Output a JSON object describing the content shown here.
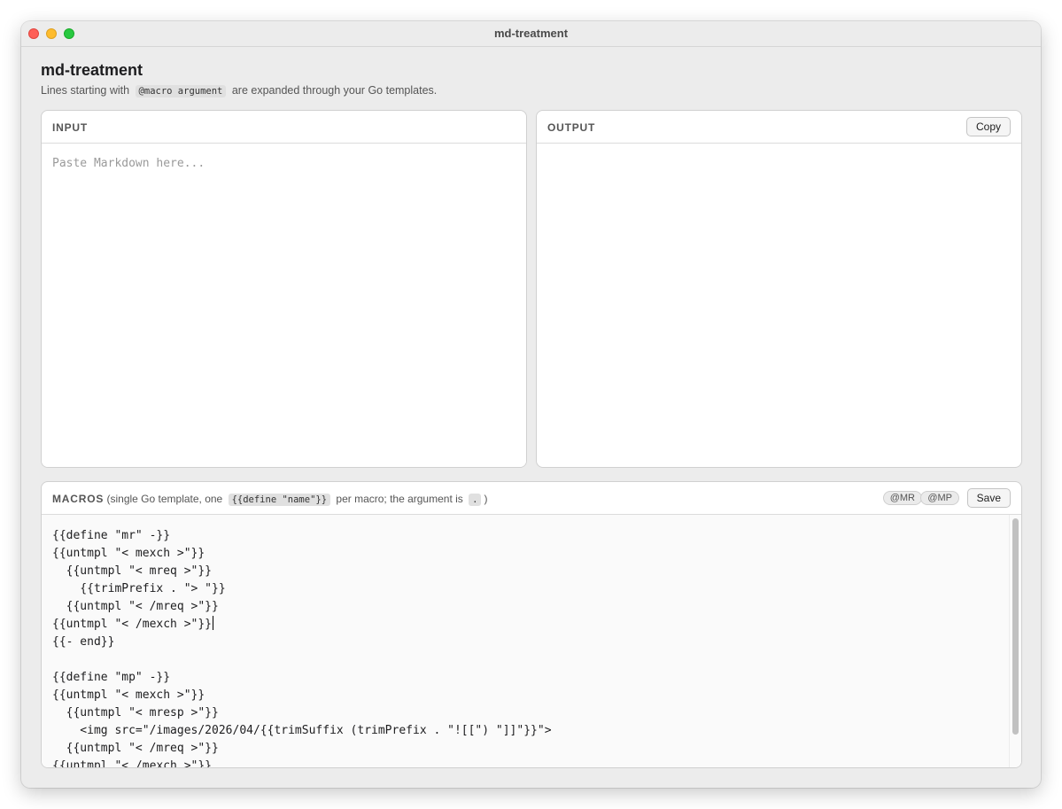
{
  "window": {
    "title": "md-treatment"
  },
  "header": {
    "title": "md-treatment",
    "subtitle_prefix": "Lines starting with",
    "subtitle_code": "@macro argument",
    "subtitle_suffix": "are expanded through your Go templates."
  },
  "input_panel": {
    "label": "INPUT",
    "placeholder": "Paste Markdown here...",
    "value": ""
  },
  "output_panel": {
    "label": "OUTPUT",
    "copy_label": "Copy",
    "value": ""
  },
  "macros_panel": {
    "label": "MACROS",
    "desc_part1": "(single Go template, one",
    "desc_code1": "{{define \"name\"}}",
    "desc_part2": "per macro; the argument is",
    "desc_code2": ".",
    "desc_part3": ")",
    "chips": [
      "@MR",
      "@MP"
    ],
    "save_label": "Save",
    "code_lines": [
      "{{define \"mr\" -}}",
      "{{untmpl \"< mexch >\"}}",
      "  {{untmpl \"< mreq >\"}}",
      "    {{trimPrefix . \"> \"}}",
      "  {{untmpl \"< /mreq >\"}}",
      "{{untmpl \"< /mexch >\"}}",
      "{{- end}}",
      "",
      "{{define \"mp\" -}}",
      "{{untmpl \"< mexch >\"}}",
      "  {{untmpl \"< mresp >\"}}",
      "    <img src=\"/images/2026/04/{{trimSuffix (trimPrefix . \"![[\") \"]]\"}}\">",
      "  {{untmpl \"< /mreq >\"}}",
      "{{untmpl \"< /mexch >\"}}"
    ],
    "cursor_line_index": 5
  },
  "icons": {
    "close": "traffic-light-close",
    "minimize": "traffic-light-minimize",
    "maximize": "traffic-light-maximize"
  },
  "colors": {
    "close": "#fe5f57",
    "minimize": "#febc2e",
    "maximize": "#28c840",
    "window_bg": "#ececec",
    "panel_bg": "#ffffff",
    "editor_bg": "#fafafa"
  }
}
